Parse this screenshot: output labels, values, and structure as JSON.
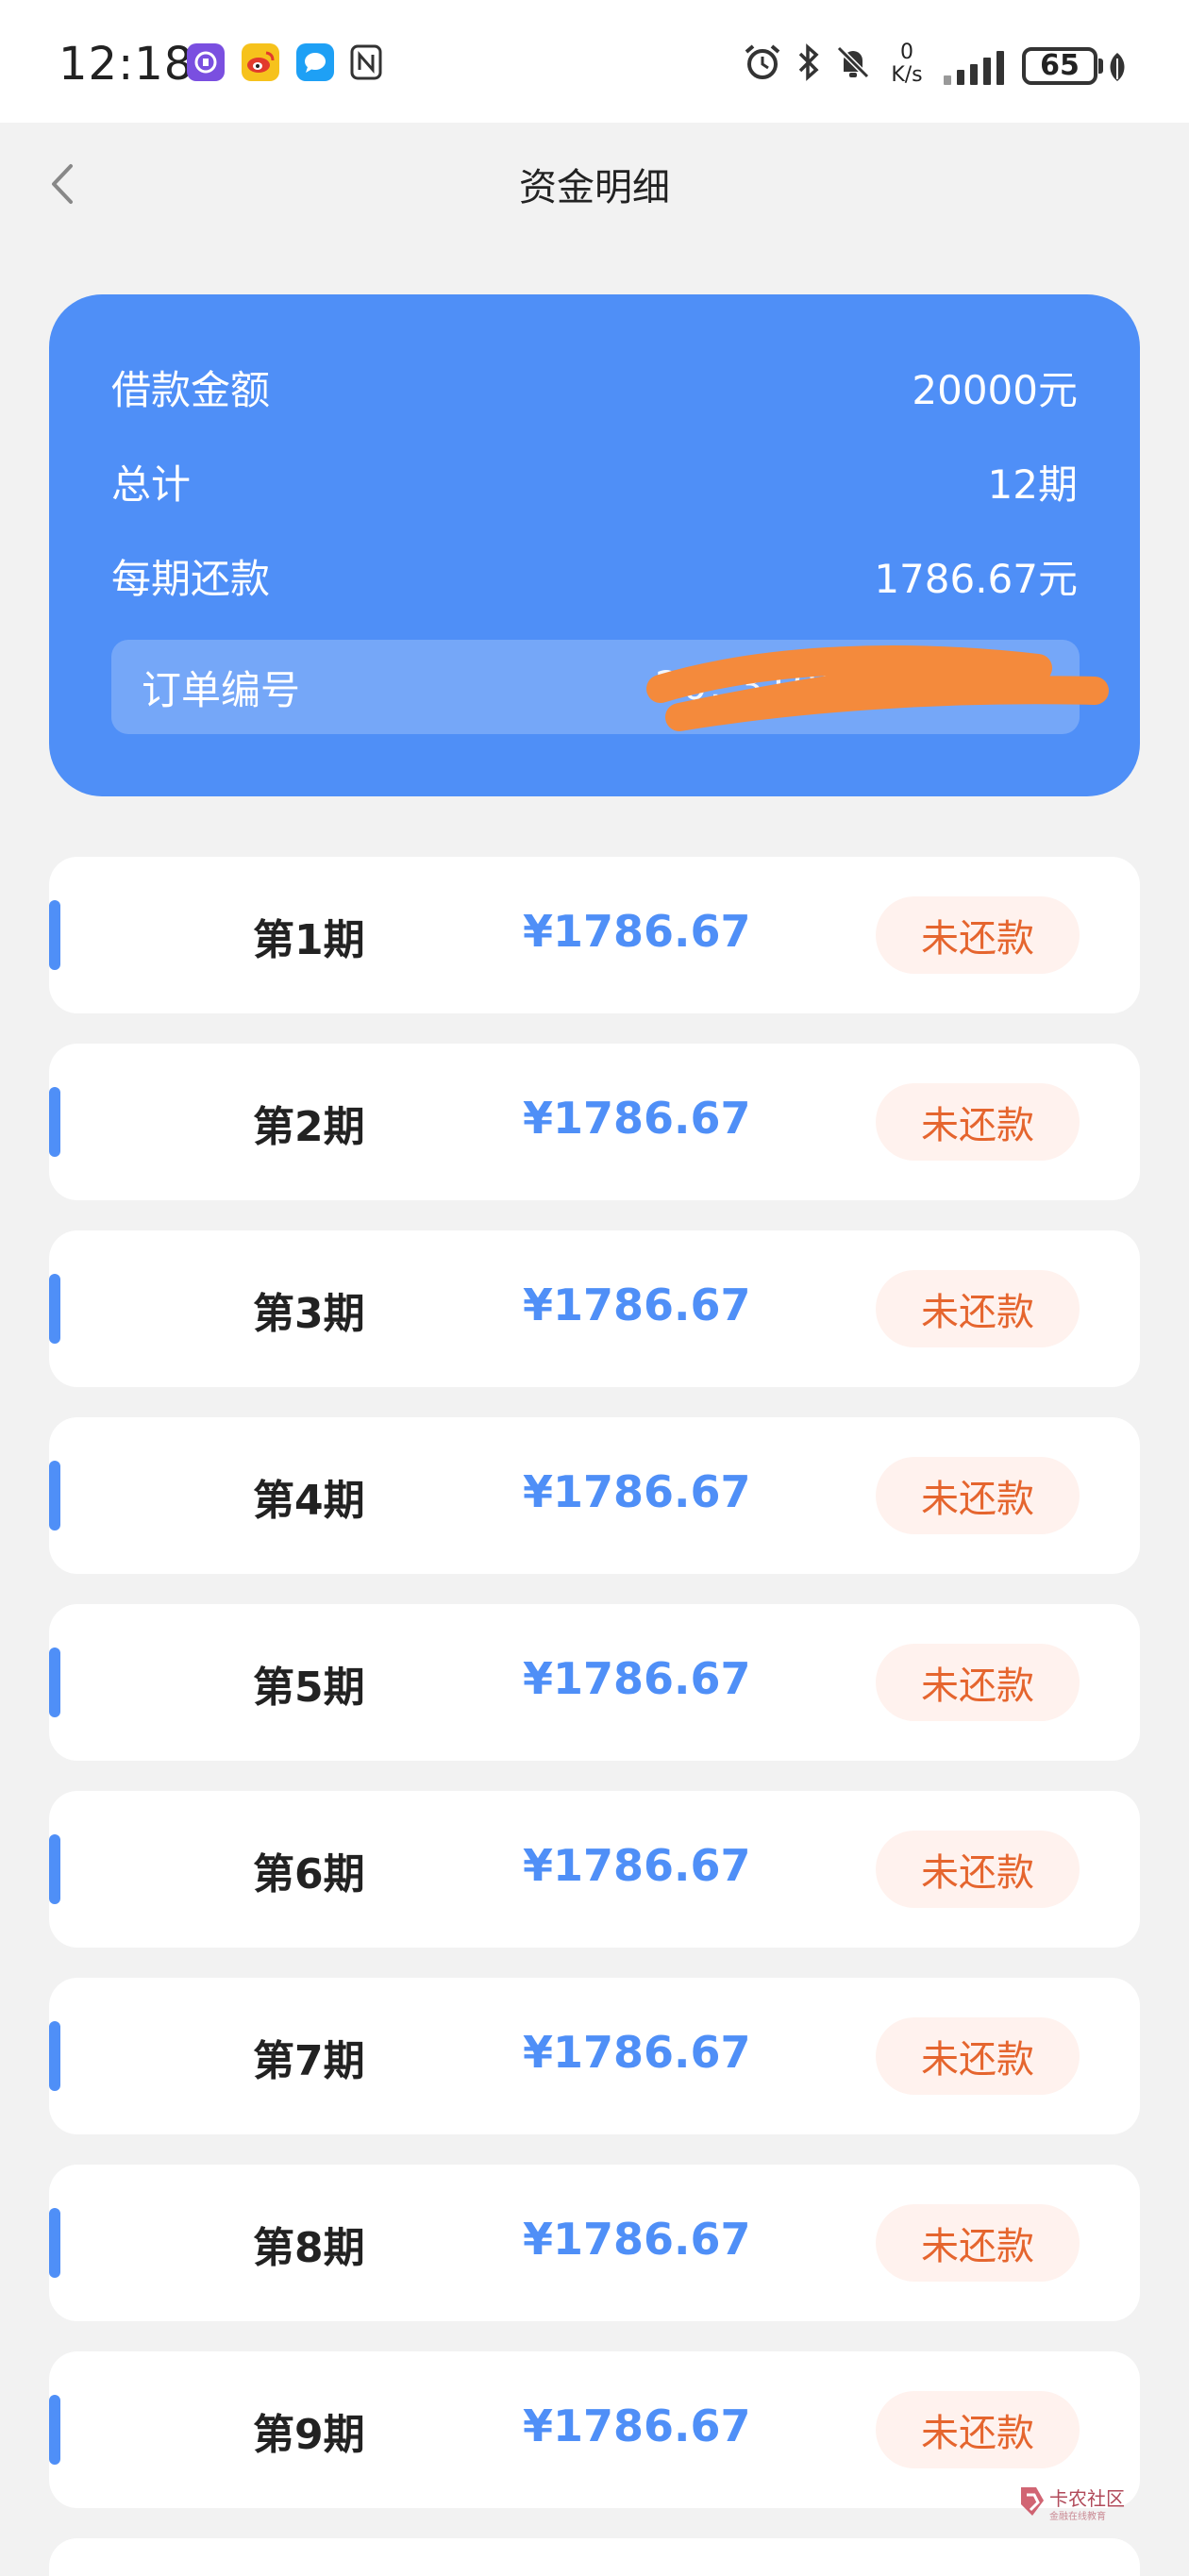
{
  "status_bar": {
    "time": "12:18",
    "net_speed_value": "0",
    "net_speed_unit": "K/s",
    "battery": "65",
    "apps": [
      "jd-icon",
      "weibo-icon",
      "message-icon",
      "nfc-icon"
    ],
    "right_icons": [
      "alarm-icon",
      "bluetooth-icon",
      "mute-icon",
      "signal-icon",
      "battery-icon",
      "leaf-icon"
    ]
  },
  "header": {
    "title": "资金明细"
  },
  "summary": {
    "rows": [
      {
        "label": "借款金额",
        "value": "20000元"
      },
      {
        "label": "总计",
        "value": "12期"
      },
      {
        "label": "每期还款",
        "value": "1786.67元"
      }
    ],
    "order_label": "订单编号",
    "order_value": "20..3105761"
  },
  "installments": [
    {
      "label": "第1期",
      "amount": "¥1786.67",
      "status": "未还款"
    },
    {
      "label": "第2期",
      "amount": "¥1786.67",
      "status": "未还款"
    },
    {
      "label": "第3期",
      "amount": "¥1786.67",
      "status": "未还款"
    },
    {
      "label": "第4期",
      "amount": "¥1786.67",
      "status": "未还款"
    },
    {
      "label": "第5期",
      "amount": "¥1786.67",
      "status": "未还款"
    },
    {
      "label": "第6期",
      "amount": "¥1786.67",
      "status": "未还款"
    },
    {
      "label": "第7期",
      "amount": "¥1786.67",
      "status": "未还款"
    },
    {
      "label": "第8期",
      "amount": "¥1786.67",
      "status": "未还款"
    },
    {
      "label": "第9期",
      "amount": "¥1786.67",
      "status": "未还款"
    }
  ],
  "watermark": {
    "text": "卡农社区",
    "sub": "金融在线教育"
  },
  "colors": {
    "accent": "#4f8ff7",
    "status_text": "#e5652e",
    "status_bg": "#fff2ee",
    "redaction": "#f48a3c"
  }
}
